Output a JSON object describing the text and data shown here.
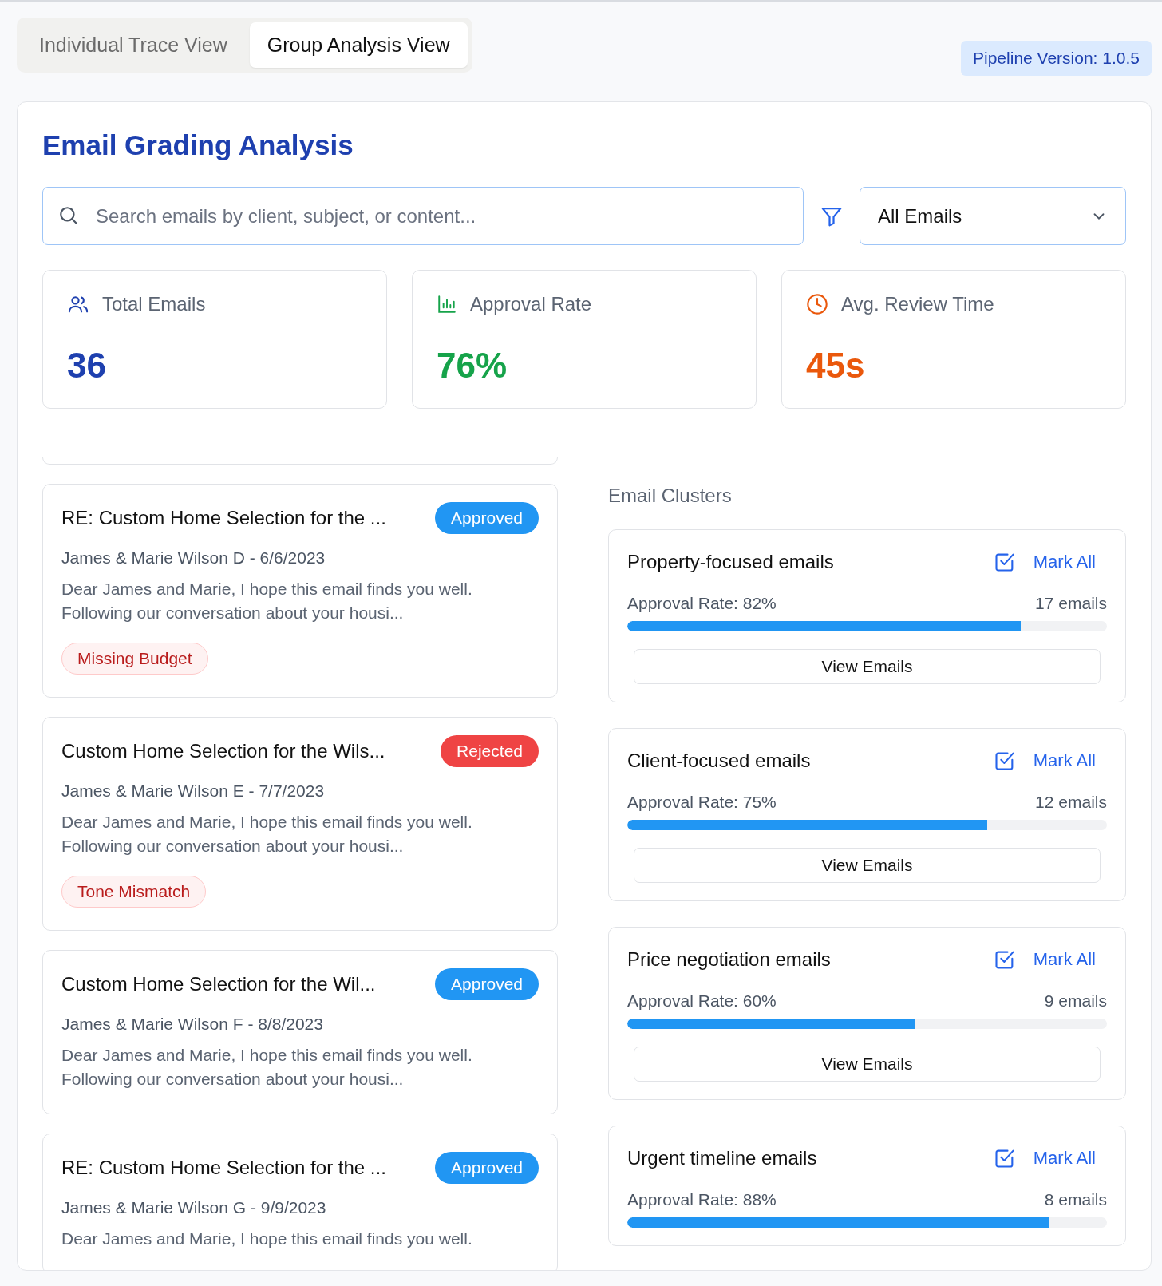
{
  "tabs": [
    {
      "label": "Individual Trace View",
      "selected": false
    },
    {
      "label": "Group Analysis View",
      "selected": true
    }
  ],
  "pipeline_version": "Pipeline Version: 1.0.5",
  "title": "Email Grading Analysis",
  "search": {
    "placeholder": "Search emails by client, subject, or content..."
  },
  "filter": {
    "value": "All Emails"
  },
  "stats": [
    {
      "kind": "users",
      "label": "Total Emails",
      "value": "36",
      "color": "#1e40af"
    },
    {
      "kind": "chart",
      "label": "Approval Rate",
      "value": "76%",
      "color": "#16a34a"
    },
    {
      "kind": "clock",
      "label": "Avg. Review Time",
      "value": "45s",
      "color": "#ea580c"
    }
  ],
  "emails": [
    {
      "subject": "RE: Custom Home Selection for the ...",
      "kind": "approved",
      "badge": "Approved",
      "sender_date": "James & Marie Wilson D - 6/6/2023",
      "preview": "Dear James and Marie, I hope this email finds you well. Following our conversation about your housi...",
      "tags": [
        "Missing Budget"
      ]
    },
    {
      "subject": "Custom Home Selection for the Wils...",
      "kind": "rejected",
      "badge": "Rejected",
      "sender_date": "James & Marie Wilson E - 7/7/2023",
      "preview": "Dear James and Marie, I hope this email finds you well. Following our conversation about your housi...",
      "tags": [
        "Tone Mismatch"
      ]
    },
    {
      "subject": "Custom Home Selection for the Wil...",
      "kind": "approved",
      "badge": "Approved",
      "sender_date": "James & Marie Wilson F - 8/8/2023",
      "preview": "Dear James and Marie, I hope this email finds you well. Following our conversation about your housi..."
    },
    {
      "subject": "RE: Custom Home Selection for the ...",
      "kind": "approved",
      "badge": "Approved",
      "sender_date": "James & Marie Wilson G - 9/9/2023",
      "preview": "Dear James and Marie, I hope this email finds you well."
    }
  ],
  "clusters_title": "Email Clusters",
  "clusters": [
    {
      "name": "Property-focused emails",
      "mark_all": "Mark All",
      "approval": "Approval Rate: 82%",
      "count": "17 emails",
      "level": 0.82,
      "view_button": "View Emails"
    },
    {
      "name": "Client-focused emails",
      "mark_all": "Mark All",
      "approval": "Approval Rate: 75%",
      "count": "12 emails",
      "level": 0.75,
      "view_button": "View Emails"
    },
    {
      "name": "Price negotiation emails",
      "mark_all": "Mark All",
      "approval": "Approval Rate: 60%",
      "count": "9 emails",
      "level": 0.6,
      "view_button": "View Emails"
    },
    {
      "name": "Urgent timeline emails",
      "mark_all": "Mark All",
      "approval": "Approval Rate: 88%",
      "count": "8 emails",
      "level": 0.88
    }
  ]
}
